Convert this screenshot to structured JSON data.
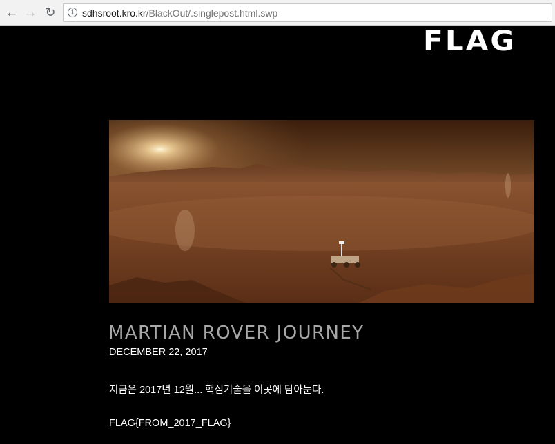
{
  "browser": {
    "url_host": "sdhsroot.kro.kr",
    "url_path": "/BlackOut/.singlepost.html.swp"
  },
  "site": {
    "brand": "FLAG"
  },
  "post": {
    "title": "MARTIAN ROVER JOURNEY",
    "date": "DECEMBER 22, 2017",
    "body": "지금은 2017년 12월... 핵심기술을 이곳에 담아둔다.",
    "flag": "FLAG{FROM_2017_FLAG}"
  },
  "colors": {
    "page_background": "#000000",
    "title_gray": "#a7a7a7",
    "text_white": "#ffffff"
  }
}
